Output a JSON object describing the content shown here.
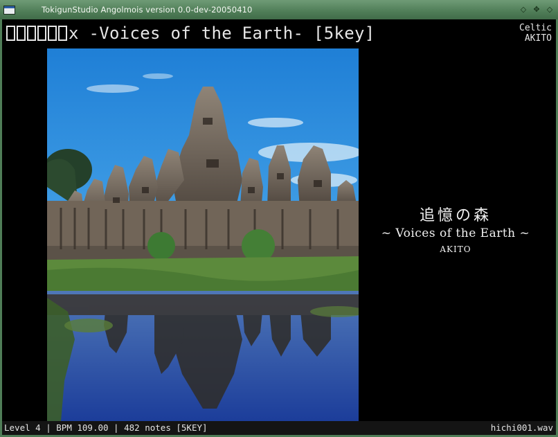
{
  "window": {
    "title": "TokigunStudio Angolmois version 0.0-dev-20050410",
    "controls": [
      "◇",
      "✥",
      "◇"
    ]
  },
  "header": {
    "song_title_glyph_count": 6,
    "song_title": "x -Voices of the Earth- [5key]",
    "genre": "Celtic",
    "artist": "AKITO"
  },
  "jacket": {
    "japanese_title": "追憶の森",
    "subtitle": "~ Voices of the Earth ~",
    "artist": "AKITO"
  },
  "status": {
    "level": "Level 4",
    "bpm": "BPM 109.00",
    "notes": "482 notes [5KEY]",
    "file": "hichi001.wav"
  },
  "colors": {
    "titlebar": "#4f7d57",
    "text": "#e6e6e6",
    "background": "#000000"
  }
}
